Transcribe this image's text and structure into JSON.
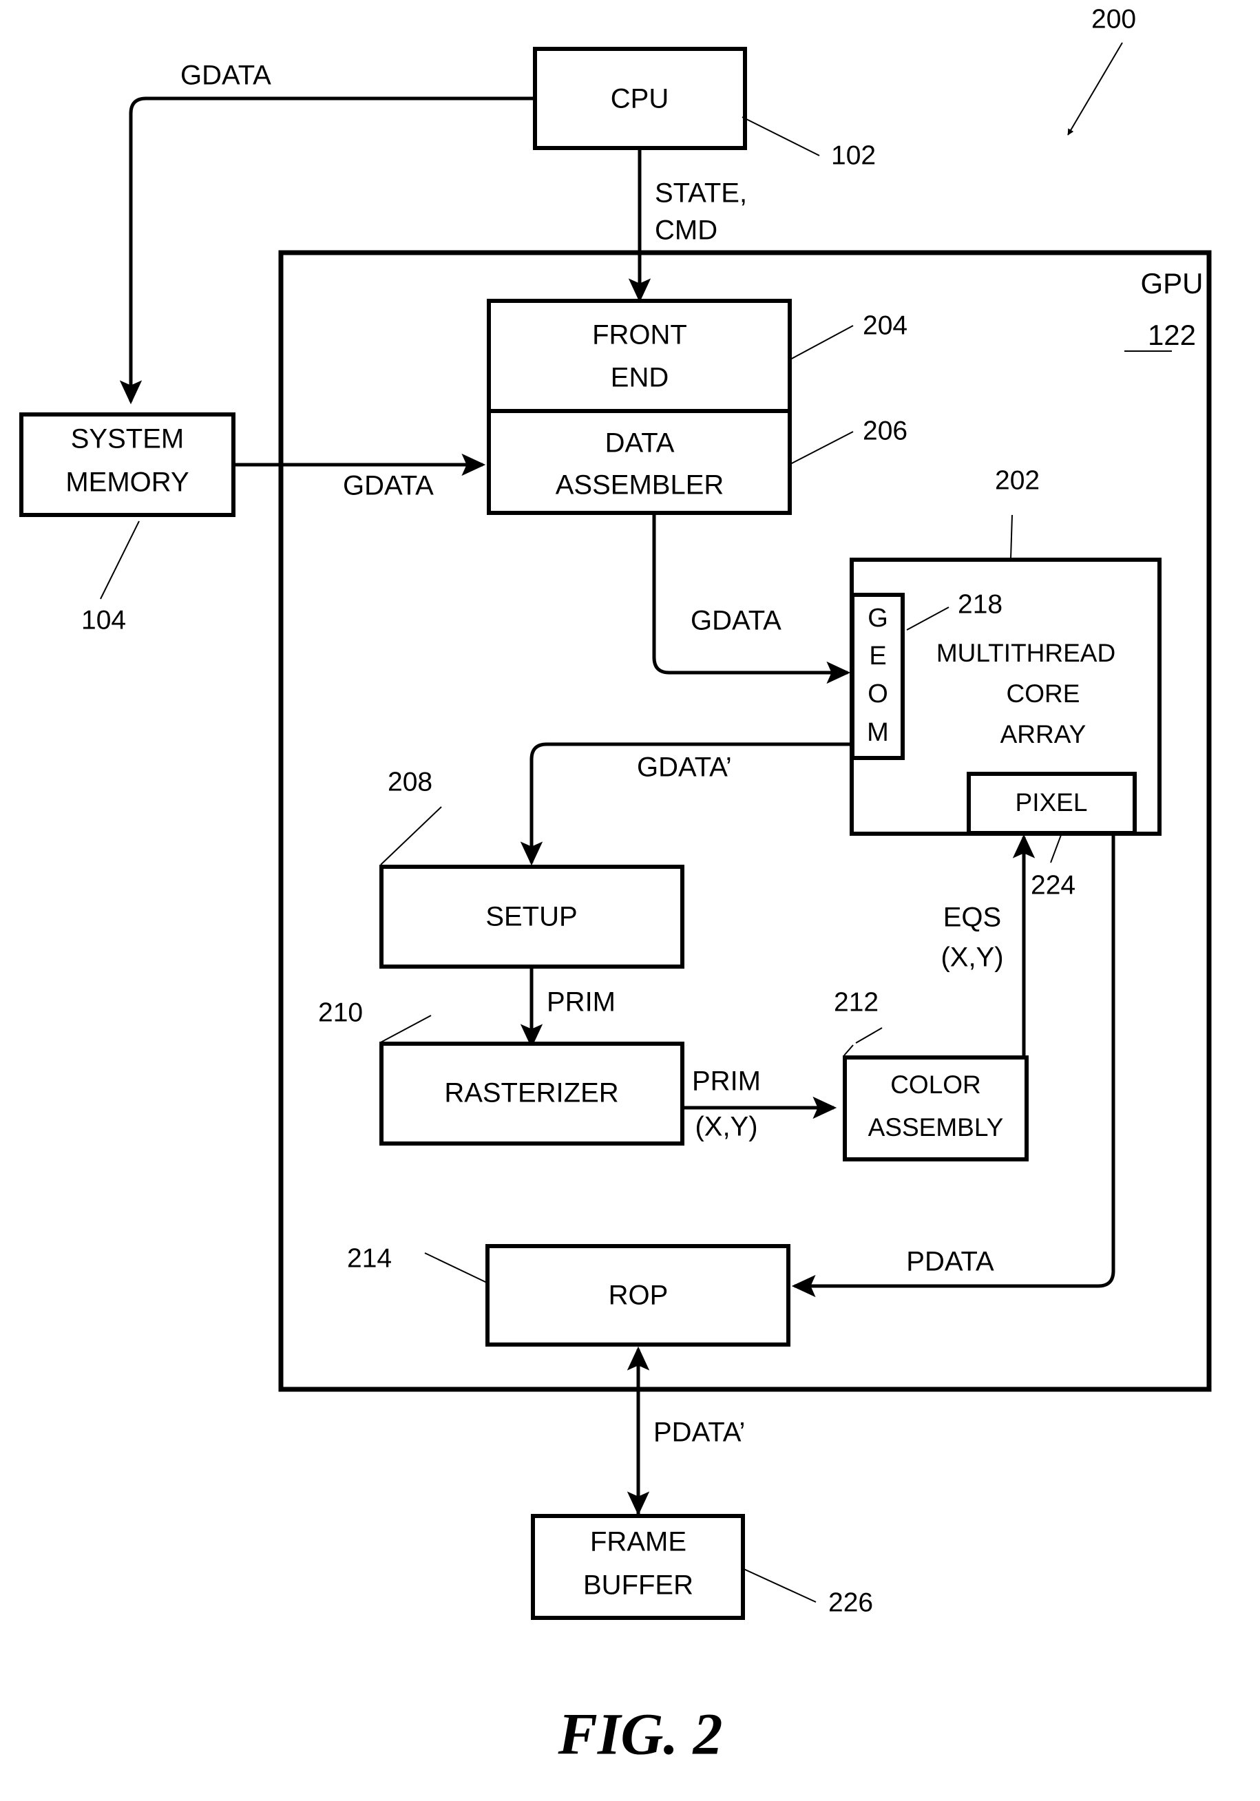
{
  "figure": {
    "caption": "FIG. 2",
    "system_ref": "200"
  },
  "blocks": {
    "cpu": {
      "label": "CPU",
      "ref": "102"
    },
    "system_memory": {
      "line1": "SYSTEM",
      "line2": "MEMORY",
      "ref": "104"
    },
    "gpu": {
      "label": "GPU",
      "ref": "122"
    },
    "front_end": {
      "line1": "FRONT",
      "line2": "END",
      "ref": "204"
    },
    "data_assembler": {
      "line1": "DATA",
      "line2": "ASSEMBLER",
      "ref": "206"
    },
    "multithread_core_array": {
      "line1": "MULTITHREAD",
      "line2": "CORE",
      "line3": "ARRAY",
      "ref": "202"
    },
    "geom": {
      "label": "GEOM",
      "letters": [
        "G",
        "E",
        "O",
        "M"
      ],
      "ref": "218"
    },
    "pixel": {
      "label": "PIXEL",
      "ref": "224"
    },
    "setup": {
      "label": "SETUP",
      "ref": "208"
    },
    "rasterizer": {
      "label": "RASTERIZER",
      "ref": "210"
    },
    "color_assembly": {
      "line1": "COLOR",
      "line2": "ASSEMBLY",
      "ref": "212"
    },
    "rop": {
      "label": "ROP",
      "ref": "214"
    },
    "frame_buffer": {
      "line1": "FRAME",
      "line2": "BUFFER",
      "ref": "226"
    }
  },
  "signals": {
    "gdata_cpu_to_memory": "GDATA",
    "state_cmd_line1": "STATE,",
    "state_cmd_line2": "CMD",
    "gdata_memory_to_assembler": "GDATA",
    "gdata_assembler_to_geom": "GDATA",
    "gdata_prime_geom_to_setup": "GDATA’",
    "prim_setup_to_rasterizer": "PRIM",
    "prim_xy_line1": "PRIM",
    "prim_xy_line2": "(X,Y)",
    "eqs_xy_line1": "EQS",
    "eqs_xy_line2": "(X,Y)",
    "pdata_pixel_to_rop": "PDATA",
    "pdata_prime_rop_to_framebuffer": "PDATA’"
  },
  "colors": {
    "ink": "#000000",
    "paper": "#ffffff"
  }
}
